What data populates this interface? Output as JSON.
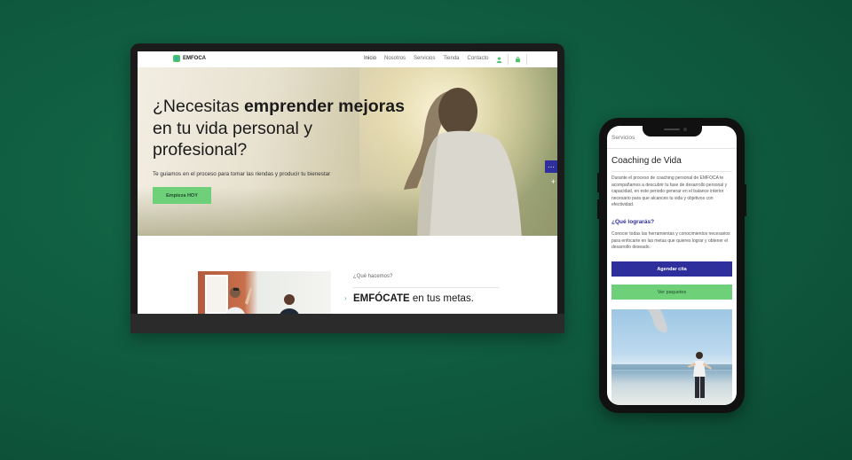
{
  "desktop": {
    "brand": "EMFOCA",
    "nav": [
      "Inicio",
      "Nosotros",
      "Servicios",
      "Tienda",
      "Contacto"
    ],
    "hero": {
      "title_pre": "¿Necesitas ",
      "title_bold": "emprender mejoras",
      "title_post": " en tu vida personal y profesional?",
      "subtitle": "Te guiamos en el proceso para tomar las riendas y producir tu bienestar",
      "cta": "Empieza HOY"
    },
    "section": {
      "eyebrow": "¿Qué hacemos?",
      "title_bold": "EMFÓCATE",
      "title_rest": " en tus metas."
    },
    "side_tab_icon": "more-icon",
    "side_plus": "+"
  },
  "mobile": {
    "breadcrumb": "Servicios",
    "title": "Coaching de Vida",
    "paragraph": "Durante el proceso de coaching personal de EMFOCA te acompañamos a descubrir tu fase de desarrollo personal y capacidad, en este periodo generar en el balance interior necesario para que alcances tu vida y objetivos con efectividad.",
    "subheading": "¿Qué lograrás?",
    "paragraph2": "Conocer todas las herramientas y conocimientos necesarios para enfocarte en las metas que quieres lograr y obtener el desarrollo deseado.",
    "btn_primary": "Agendar cita",
    "btn_secondary": "Ver paquetes"
  },
  "colors": {
    "background": "#0f5a3f",
    "accent_green": "#6fd07a",
    "accent_blue": "#2e2e9c"
  }
}
